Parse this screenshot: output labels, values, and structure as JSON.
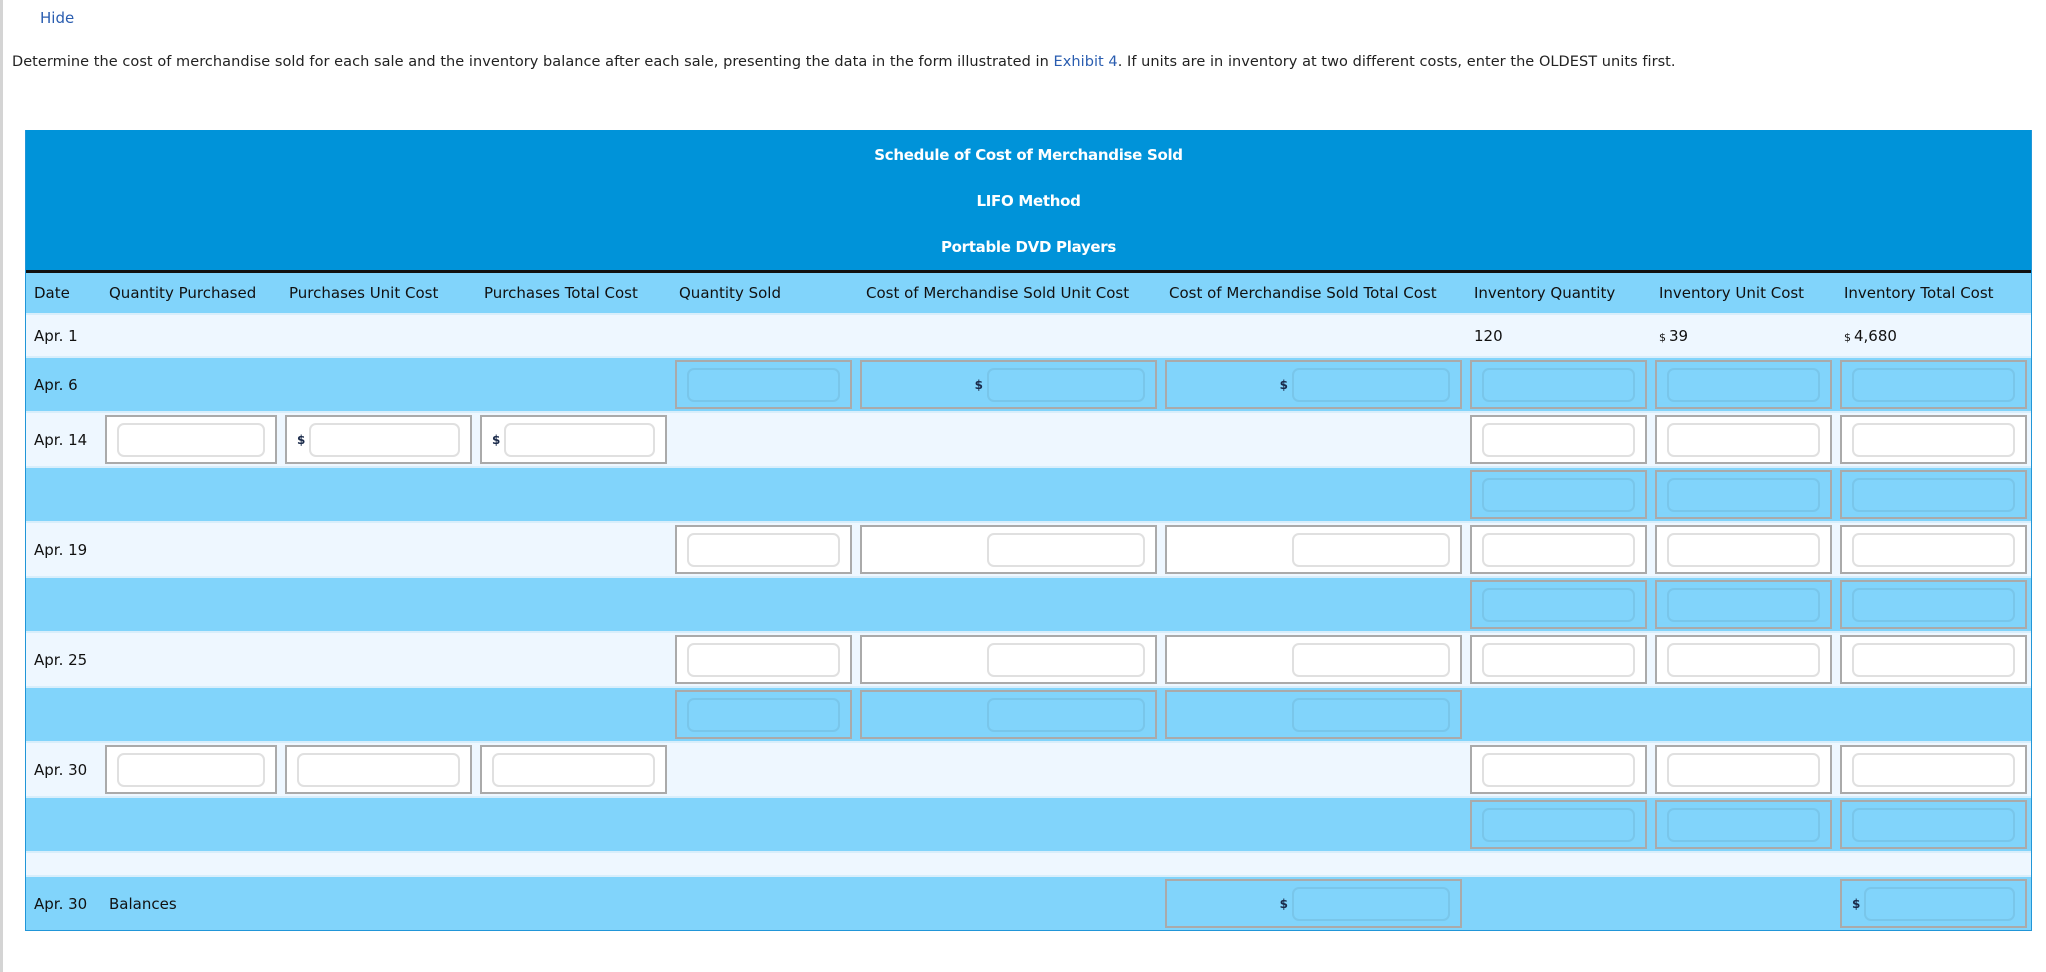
{
  "hide_link": "Hide",
  "instructions": {
    "before": "Determine the cost of merchandise sold for each sale and the inventory balance after each sale, presenting the data in the form illustrated in ",
    "link": "Exhibit 4",
    "after": ". If units are in inventory at two different costs, enter the OLDEST units first."
  },
  "schedule": {
    "title": "Schedule of Cost of Merchandise Sold",
    "method": "LIFO Method",
    "product": "Portable DVD Players"
  },
  "columns": [
    "Date",
    "Quantity Purchased",
    "Purchases Unit Cost",
    "Purchases Total Cost",
    "Quantity Sold",
    "Cost of Merchandise Sold Unit Cost",
    "Cost of Merchandise Sold Total Cost",
    "Inventory Quantity",
    "Inventory Unit Cost",
    "Inventory Total Cost"
  ],
  "currency_symbol": "$",
  "rows": {
    "apr1": {
      "date": "Apr. 1",
      "inventory_quantity": "120",
      "inventory_unit_cost": "39",
      "inventory_total_cost": "4,680"
    },
    "apr6": {
      "date": "Apr. 6"
    },
    "apr14": {
      "date": "Apr. 14"
    },
    "apr19": {
      "date": "Apr. 19"
    },
    "apr25": {
      "date": "Apr. 25"
    },
    "apr30": {
      "date": "Apr. 30"
    },
    "balances": {
      "date": "Apr. 30",
      "label": "Balances"
    }
  },
  "inputs": {
    "placeholder": "",
    "value": ""
  }
}
